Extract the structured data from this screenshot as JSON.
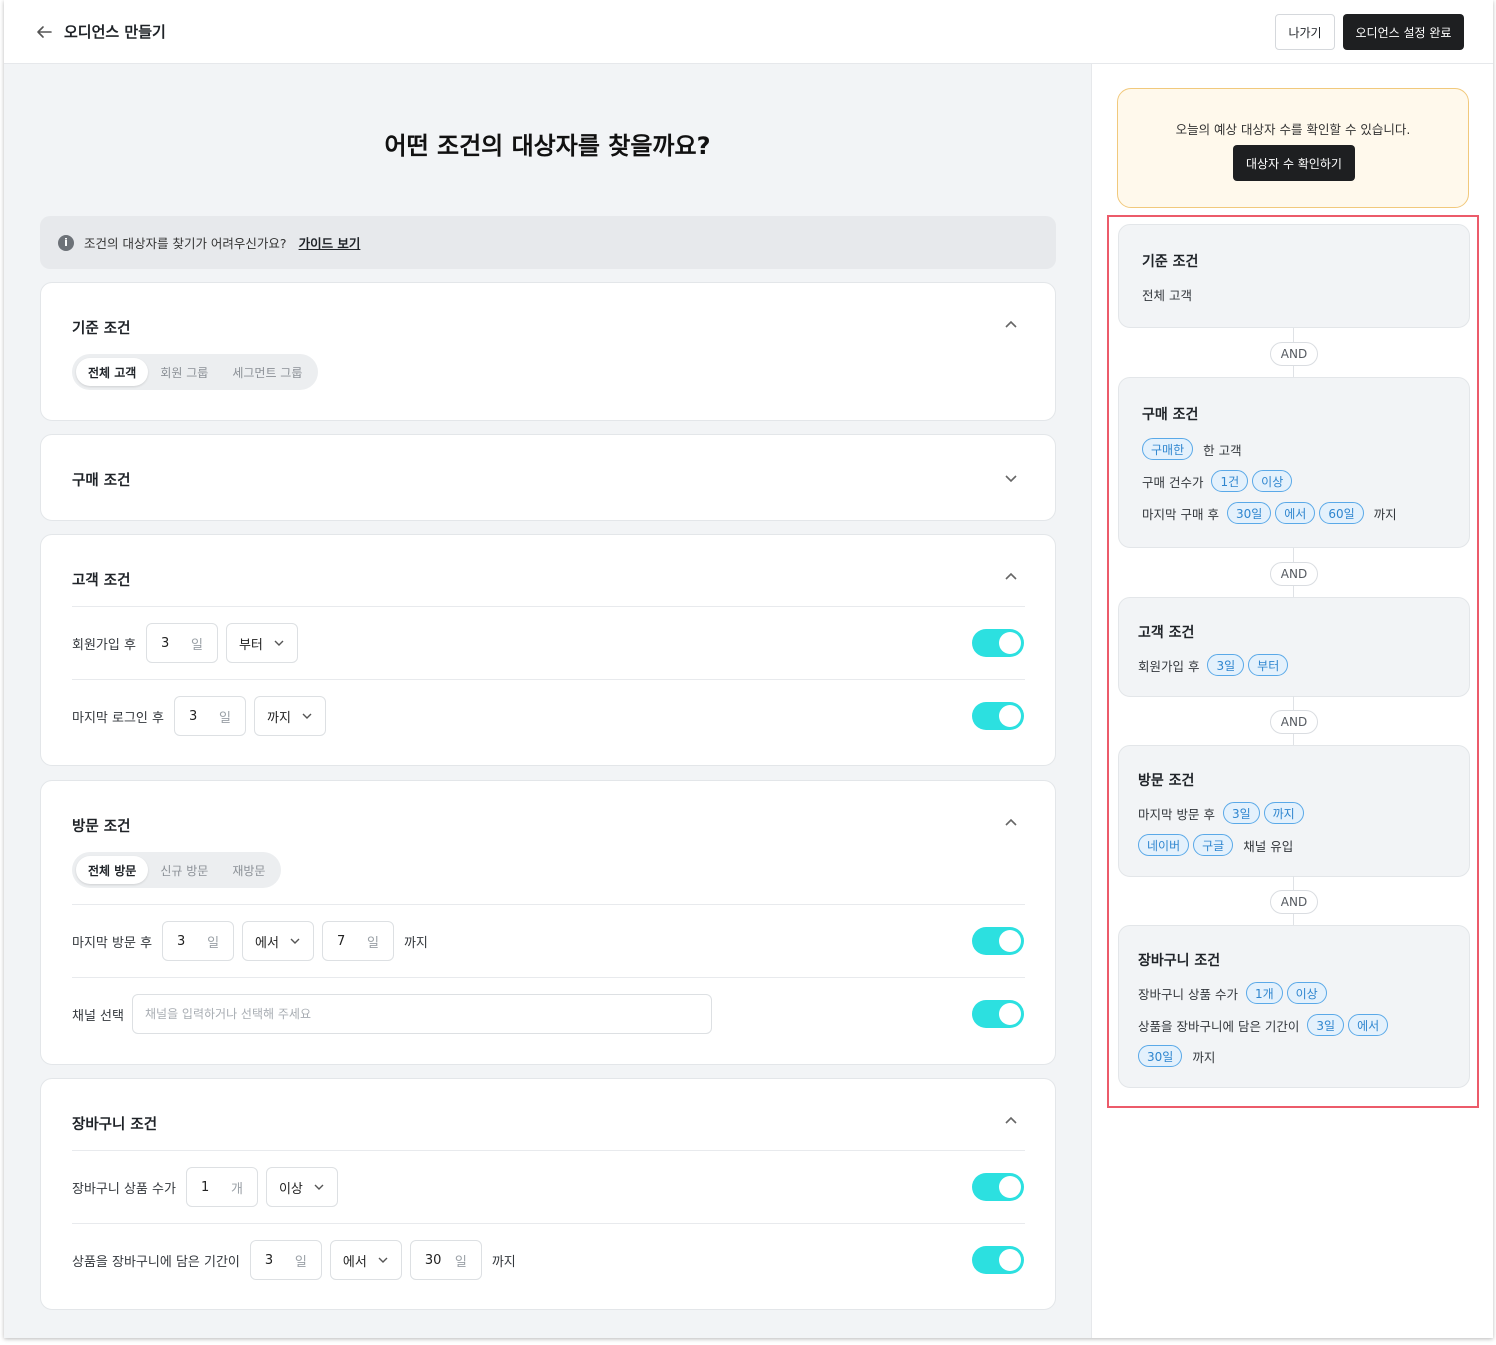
{
  "header": {
    "title": "오디언스 만들기",
    "exit_label": "나가기",
    "done_label": "오디언스 설정 완료"
  },
  "main": {
    "title": "어떤 조건의 대상자를 찾을까요?"
  },
  "guide": {
    "text": "조건의 대상자를 찾기가 어려우신가요?",
    "link": "가이드 보기",
    "icon": "i"
  },
  "base": {
    "title": "기준 조건",
    "options": [
      "전체 고객",
      "회원 그룹",
      "세그먼트 그룹"
    ]
  },
  "purchase": {
    "title": "구매 조건"
  },
  "customer": {
    "title": "고객 조건",
    "rows": [
      {
        "label": "회원가입 후",
        "value": "3",
        "unit": "일",
        "select": "부터"
      },
      {
        "label": "마지막 로그인 후",
        "value": "3",
        "unit": "일",
        "select": "까지"
      }
    ]
  },
  "visit": {
    "title": "방문 조건",
    "options": [
      "전체 방문",
      "신규 방문",
      "재방문"
    ],
    "row1": {
      "label": "마지막 방문 후",
      "value1": "3",
      "unit": "일",
      "select": "에서",
      "value2": "7",
      "tail": "까지"
    },
    "row2": {
      "label": "채널 선택",
      "placeholder": "채널을 입력하거나 선택해 주세요"
    }
  },
  "cart": {
    "title": "장바구니 조건",
    "row1": {
      "label": "장바구니 상품 수가",
      "value": "1",
      "unit": "개",
      "select": "이상"
    },
    "row2": {
      "label": "상품을 장바구니에 담은 기간이",
      "value1": "3",
      "unit": "일",
      "select": "에서",
      "value2": "30",
      "tail": "까지"
    }
  },
  "estimate": {
    "text": "오늘의 예상 대상자 수를 확인할 수 있습니다.",
    "button": "대상자 수 확인하기"
  },
  "summary": {
    "and": "AND",
    "base": {
      "title": "기준 조건",
      "value": "전체 고객"
    },
    "purchase": {
      "title": "구매 조건",
      "l1": {
        "chip": "구매한",
        "txt": "한 고객"
      },
      "l2": {
        "txt": "구매 건수가",
        "c1": "1건",
        "c2": "이상"
      },
      "l3": {
        "txt": "마지막 구매 후",
        "c1": "30일",
        "c2": "에서",
        "c3": "60일",
        "tail": "까지"
      }
    },
    "customer": {
      "title": "고객 조건",
      "l1": {
        "txt": "회원가입 후",
        "c1": "3일",
        "c2": "부터"
      }
    },
    "visit": {
      "title": "방문 조건",
      "l1": {
        "txt": "마지막 방문 후",
        "c1": "3일",
        "c2": "까지"
      },
      "l2": {
        "c1": "네이버",
        "c2": "구글",
        "tail": "채널 유입"
      }
    },
    "cart": {
      "title": "장바구니 조건",
      "l1": {
        "txt": "장바구니 상품 수가",
        "c1": "1개",
        "c2": "이상"
      },
      "l2": {
        "txt": "상품을 장바구니에 담은 기간이",
        "c1": "3일",
        "c2": "에서"
      },
      "l3": {
        "c1": "30일",
        "tail": "까지"
      }
    }
  },
  "colors": {
    "toggle": "#2ce0e0",
    "chip_border": "#5aa9e8",
    "highlight": "#ec5b6a",
    "dark_button": "#1e1f21"
  }
}
